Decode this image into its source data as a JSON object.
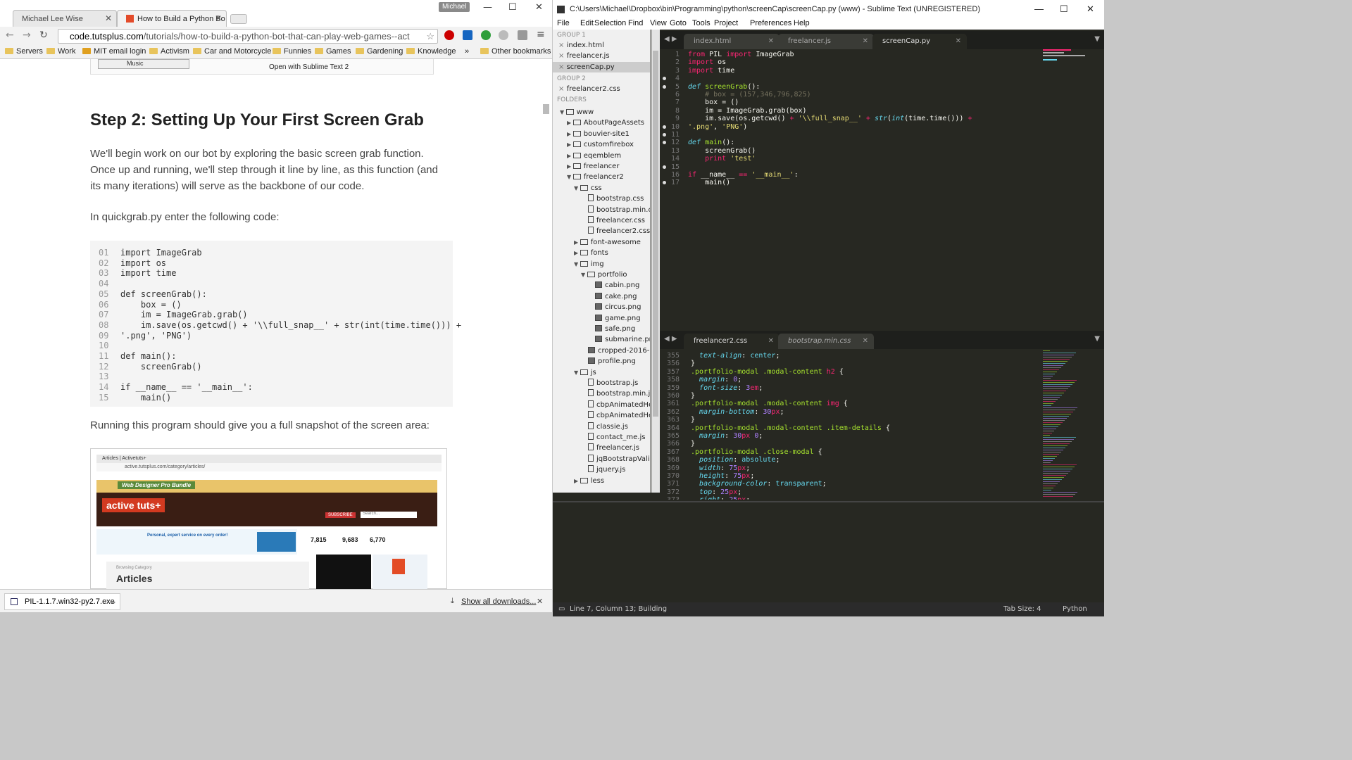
{
  "browser": {
    "tabs": [
      {
        "label": "Michael Lee Wise",
        "active": false
      },
      {
        "label": "How to Build a Python Bo",
        "active": true
      }
    ],
    "profile_badge": "Michael",
    "url_domain": "code.tutsplus.com",
    "url_path": "/tutorials/how-to-build-a-python-bot-that-can-play-web-games--act",
    "bookmarks": [
      "Servers",
      "Work",
      "MIT email login",
      "Activism",
      "Car and Motorcycle",
      "Funnies",
      "Games",
      "Gardening",
      "Knowledge",
      "»",
      "Other bookmarks"
    ],
    "top_snippet": "Open with Sublime Text 2",
    "top_snippet_music": "Music",
    "heading": "Step 2: Setting Up Your First Screen Grab",
    "para1": "We'll begin work on our bot by exploring the basic screen grab function. Once up and running, we'll step through it line by line, as this function (and its many iterations) will serve as the backbone of our code.",
    "para2": "In quickgrab.py enter the following code:",
    "code_lines": [
      {
        "n": "01",
        "t": "import ImageGrab"
      },
      {
        "n": "02",
        "t": "import os"
      },
      {
        "n": "03",
        "t": "import time"
      },
      {
        "n": "04",
        "t": ""
      },
      {
        "n": "05",
        "t": "def screenGrab():"
      },
      {
        "n": "06",
        "t": "    box = ()"
      },
      {
        "n": "07",
        "t": "    im = ImageGrab.grab()"
      },
      {
        "n": "08",
        "t": "    im.save(os.getcwd() + '\\\\full_snap__' + str(int(time.time())) +"
      },
      {
        "n": "09",
        "t": "'.png', 'PNG')"
      },
      {
        "n": "10",
        "t": ""
      },
      {
        "n": "11",
        "t": "def main():"
      },
      {
        "n": "12",
        "t": "    screenGrab()"
      },
      {
        "n": "13",
        "t": ""
      },
      {
        "n": "14",
        "t": "if __name__ == '__main__':"
      },
      {
        "n": "15",
        "t": "    main()"
      }
    ],
    "para3": "Running this program should give you a full snapshot of the screen area:",
    "download_file": "PIL-1.1.7.win32-py2.7.exe",
    "show_downloads": "Show all downloads...",
    "embedded": {
      "url": "active.tutsplus.com/category/articles/",
      "tab": "Articles | Activetuts+",
      "banner": "Web Designer Pro Bundle",
      "logo": "active tuts+",
      "subscribe": "SUBSCRIBE",
      "search": "Search...",
      "ad_text": "Personal, expert service on every order!",
      "stats": [
        "7,815",
        "9,683",
        "6,770"
      ],
      "section": "Articles",
      "browsing": "Browsing Category"
    }
  },
  "sublime": {
    "title": "C:\\Users\\Michael\\Dropbox\\bin\\Programming\\python\\screenCap\\screenCap.py (www) - Sublime Text (UNREGISTERED)",
    "menu": [
      "File",
      "Edit",
      "Selection",
      "Find",
      "View",
      "Goto",
      "Tools",
      "Project",
      "Preferences",
      "Help"
    ],
    "group1_label": "GROUP 1",
    "group1_files": [
      "index.html",
      "freelancer.js",
      "screenCap.py"
    ],
    "group2_label": "GROUP 2",
    "group2_files": [
      "freelancer2.css"
    ],
    "folders_label": "FOLDERS",
    "tree": [
      {
        "d": 0,
        "k": "open",
        "n": "www"
      },
      {
        "d": 1,
        "k": "closed",
        "n": "AboutPageAssets"
      },
      {
        "d": 1,
        "k": "closed",
        "n": "bouvier-site1"
      },
      {
        "d": 1,
        "k": "closed",
        "n": "customfirebox"
      },
      {
        "d": 1,
        "k": "closed",
        "n": "eqemblem"
      },
      {
        "d": 1,
        "k": "closed",
        "n": "freelancer"
      },
      {
        "d": 1,
        "k": "open",
        "n": "freelancer2"
      },
      {
        "d": 2,
        "k": "open",
        "n": "css"
      },
      {
        "d": 3,
        "k": "file",
        "n": "bootstrap.css"
      },
      {
        "d": 3,
        "k": "file",
        "n": "bootstrap.min.css"
      },
      {
        "d": 3,
        "k": "file",
        "n": "freelancer.css"
      },
      {
        "d": 3,
        "k": "file",
        "n": "freelancer2.css"
      },
      {
        "d": 2,
        "k": "closed",
        "n": "font-awesome"
      },
      {
        "d": 2,
        "k": "closed",
        "n": "fonts"
      },
      {
        "d": 2,
        "k": "open",
        "n": "img"
      },
      {
        "d": 3,
        "k": "open",
        "n": "portfolio"
      },
      {
        "d": 4,
        "k": "img",
        "n": "cabin.png"
      },
      {
        "d": 4,
        "k": "img",
        "n": "cake.png"
      },
      {
        "d": 4,
        "k": "img",
        "n": "circus.png"
      },
      {
        "d": 4,
        "k": "img",
        "n": "game.png"
      },
      {
        "d": 4,
        "k": "img",
        "n": "safe.png"
      },
      {
        "d": 4,
        "k": "img",
        "n": "submarine.png"
      },
      {
        "d": 3,
        "k": "img",
        "n": "cropped-2016-03-"
      },
      {
        "d": 3,
        "k": "img",
        "n": "profile.png"
      },
      {
        "d": 2,
        "k": "open",
        "n": "js"
      },
      {
        "d": 3,
        "k": "file",
        "n": "bootstrap.js"
      },
      {
        "d": 3,
        "k": "file",
        "n": "bootstrap.min.js"
      },
      {
        "d": 3,
        "k": "file",
        "n": "cbpAnimatedHea"
      },
      {
        "d": 3,
        "k": "file",
        "n": "cbpAnimatedHea"
      },
      {
        "d": 3,
        "k": "file",
        "n": "classie.js"
      },
      {
        "d": 3,
        "k": "file",
        "n": "contact_me.js"
      },
      {
        "d": 3,
        "k": "file",
        "n": "freelancer.js"
      },
      {
        "d": 3,
        "k": "file",
        "n": "jqBootstrapValida"
      },
      {
        "d": 3,
        "k": "file",
        "n": "jquery.js"
      },
      {
        "d": 2,
        "k": "closed",
        "n": "less"
      }
    ],
    "top_tabs": [
      "index.html",
      "freelancer.js",
      "screenCap.py"
    ],
    "bottom_tabs": [
      "freelancer2.css",
      "bootstrap.min.css"
    ],
    "status_left": "Line 7, Column 13; Building",
    "tab_size": "Tab Size: 4",
    "syntax": "Python"
  }
}
